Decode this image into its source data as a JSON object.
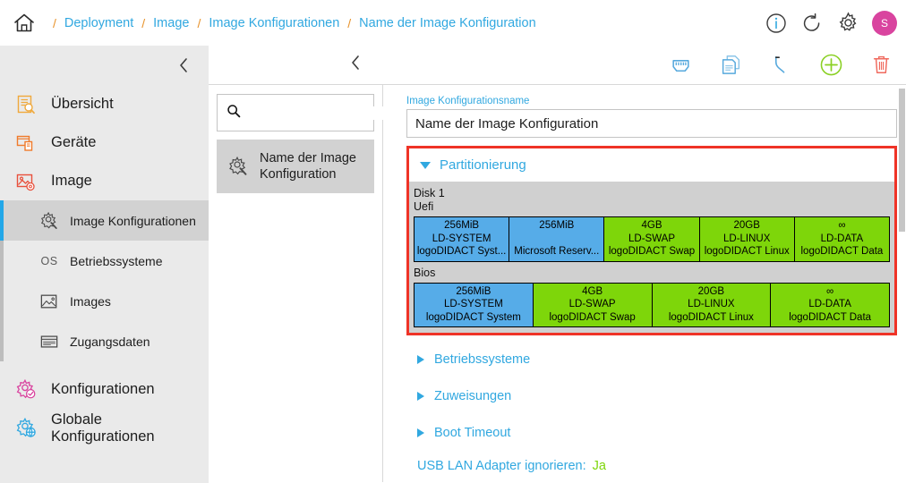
{
  "breadcrumb": {
    "home_icon": "home-icon",
    "separator": "/",
    "items": [
      {
        "label": "Deployment"
      },
      {
        "label": "Image"
      },
      {
        "label": "Image Konfigurationen"
      },
      {
        "label": "Name der Image Konfiguration"
      }
    ]
  },
  "topbar_actions": [
    {
      "name": "info-icon",
      "glyph": "i"
    },
    {
      "name": "refresh-icon",
      "glyph": "refresh"
    },
    {
      "name": "gear-icon",
      "glyph": "gear"
    }
  ],
  "avatar": {
    "initial": "S",
    "color": "#d9449f"
  },
  "sidebar": {
    "collapse_label": "collapse-sidebar",
    "items": [
      {
        "label": "Übersicht",
        "icon": "overview-icon",
        "color": "#f0a93c"
      },
      {
        "label": "Geräte",
        "icon": "devices-icon",
        "color": "#f07a2a"
      },
      {
        "label": "Image",
        "icon": "image-icon",
        "color": "#e8503c"
      }
    ],
    "subitems": [
      {
        "label": "Image Konfigurationen",
        "icon": "image-config-icon",
        "active": true
      },
      {
        "label": "Betriebssysteme",
        "icon": "os-icon",
        "active": false
      },
      {
        "label": "Images",
        "icon": "images-icon",
        "active": false
      },
      {
        "label": "Zugangsdaten",
        "icon": "credentials-icon",
        "active": false
      }
    ],
    "bottom_items": [
      {
        "label": "Konfigurationen",
        "icon": "configurations-icon",
        "color": "#d9449f"
      },
      {
        "label": "Globale Konfigurationen",
        "icon": "global-configurations-icon",
        "color": "#31a8e0"
      }
    ]
  },
  "toolbar": {
    "back_label": "back",
    "actions": [
      {
        "name": "network-port-icon",
        "color": "#57a9dd"
      },
      {
        "name": "duplicate-icon",
        "color": "#57a9dd"
      },
      {
        "name": "undo-icon",
        "color": "#57a9dd"
      },
      {
        "name": "add-icon",
        "color": "#8ad023"
      },
      {
        "name": "delete-icon",
        "color": "#f06a5e"
      }
    ]
  },
  "list_pane": {
    "search_placeholder": "",
    "search_value": "",
    "items": [
      {
        "label": "Name der Image Konfiguration",
        "icon": "image-config-icon",
        "selected": true
      }
    ]
  },
  "detail": {
    "name_field": {
      "label": "Image Konfigurationsname",
      "value": "Name der Image Konfiguration",
      "placeholder": ""
    },
    "partitioning": {
      "title": "Partitionierung",
      "expanded": true,
      "disk_label": "Disk 1",
      "schemes": [
        {
          "name": "Uefi",
          "partitions": [
            {
              "size": "256MiB",
              "label": "LD-SYSTEM",
              "name": "logoDIDACT Syst...",
              "color": "#56ace8"
            },
            {
              "size": "256MiB",
              "label": "",
              "name": "Microsoft Reserv...",
              "color": "#56ace8"
            },
            {
              "size": "4GB",
              "label": "LD-SWAP",
              "name": "logoDIDACT Swap",
              "color": "#7ed60a"
            },
            {
              "size": "20GB",
              "label": "LD-LINUX",
              "name": "logoDIDACT Linux",
              "color": "#7ed60a"
            },
            {
              "size": "∞",
              "label": "LD-DATA",
              "name": "logoDIDACT Data",
              "color": "#7ed60a"
            }
          ]
        },
        {
          "name": "Bios",
          "partitions": [
            {
              "size": "256MiB",
              "label": "LD-SYSTEM",
              "name": "logoDIDACT System",
              "color": "#56ace8"
            },
            {
              "size": "4GB",
              "label": "LD-SWAP",
              "name": "logoDIDACT Swap",
              "color": "#7ed60a"
            },
            {
              "size": "20GB",
              "label": "LD-LINUX",
              "name": "logoDIDACT Linux",
              "color": "#7ed60a"
            },
            {
              "size": "∞",
              "label": "LD-DATA",
              "name": "logoDIDACT Data",
              "color": "#7ed60a"
            }
          ]
        }
      ]
    },
    "sections": [
      {
        "title": "Betriebssysteme",
        "expanded": false
      },
      {
        "title": "Zuweisungen",
        "expanded": false
      },
      {
        "title": "Boot Timeout",
        "expanded": false
      }
    ],
    "usb_lan": {
      "key": "USB LAN Adapter ignorieren:",
      "value": "Ja"
    }
  },
  "colors": {
    "accent_blue": "#31a8e0",
    "highlight_red": "#ef3327",
    "partition_blue": "#56ace8",
    "partition_green": "#7ed60a",
    "avatar_pink": "#d9449f"
  }
}
